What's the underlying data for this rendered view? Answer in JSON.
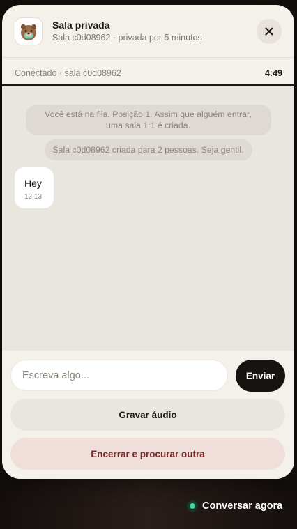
{
  "header": {
    "title": "Sala privada",
    "subtitle": "Sala c0d08962 · privada por 5 minutos",
    "avatar_icon": "bear-avatar-icon",
    "close_icon": "close-icon"
  },
  "status": {
    "text": "Conectado · sala c0d08962",
    "timer": "4:49",
    "progress": 1.0
  },
  "messages": {
    "system": [
      "Você está na fila. Posição 1. Assim que alguém entrar, uma sala 1:1 é criada.",
      "Sala c0d08962 criada para 2 pessoas. Seja gentil."
    ],
    "bubbles": [
      {
        "text": "Hey",
        "time": "12:13"
      }
    ]
  },
  "composer": {
    "placeholder": "Escreva algo...",
    "value": "",
    "send_label": "Enviar",
    "audio_label": "Gravar áudio",
    "end_label": "Encerrar e procurar outra"
  },
  "fab": {
    "label": "Conversar agora",
    "status_color": "#3fd39a"
  },
  "colors": {
    "accent_dark": "#161311",
    "panel_bg": "#f4f1ea",
    "chat_bg": "#e9e6df",
    "danger_bg": "#f0dedb",
    "danger_text": "#7a2a2a",
    "online_green": "#3fd39a"
  }
}
